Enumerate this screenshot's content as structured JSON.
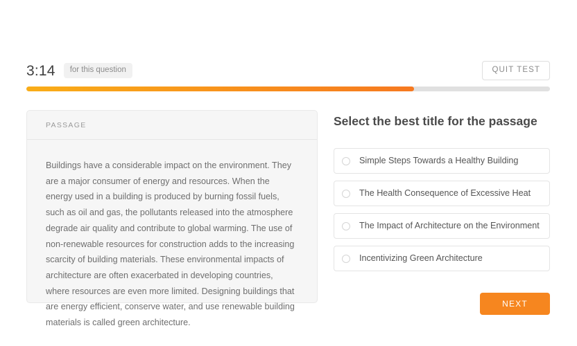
{
  "topbar": {
    "timer": "3:14",
    "timer_note": "for this question",
    "quit_label": "QUIT TEST"
  },
  "progress": {
    "percent": 74,
    "fill_start_color": "#f9ad18",
    "fill_end_color": "#f67920",
    "track_color": "#e0e0e0"
  },
  "passage": {
    "header_label": "PASSAGE",
    "text": "Buildings have a considerable impact on the environment. They are a major consumer of energy and resources. When the energy used in a building is produced by burning fossil fuels, such as oil and gas, the pollutants released into the atmosphere degrade air quality and contribute to global warming. The use of non-renewable resources for construction adds to the increasing scarcity of building materials. These environmental impacts of architecture are often exacerbated in developing countries, where resources are even more limited. Designing buildings that are energy efficient, conserve water, and use renewable building materials is called green architecture."
  },
  "question": {
    "title": "Select the best title for the passage",
    "options": [
      {
        "label": "Simple Steps Towards a Healthy Building",
        "selected": false
      },
      {
        "label": "The Health Consequence of Excessive Heat",
        "selected": false
      },
      {
        "label": "The Impact of Architecture on the Environment",
        "selected": false
      },
      {
        "label": "Incentivizing Green Architecture",
        "selected": false
      }
    ],
    "next_label": "NEXT",
    "next_color": "#f6861f"
  }
}
